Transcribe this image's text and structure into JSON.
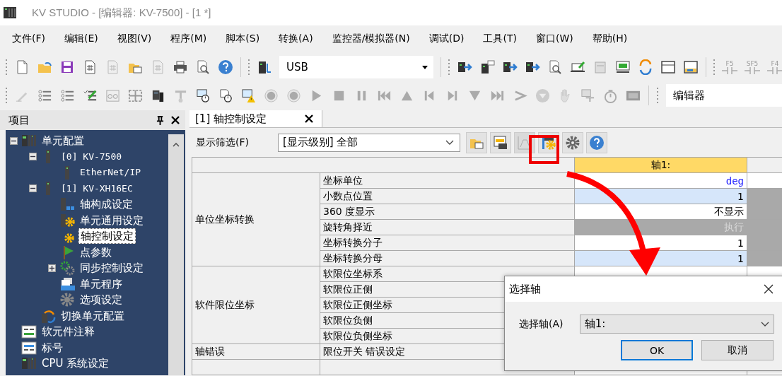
{
  "window": {
    "title": "KV STUDIO - [编辑器: KV-7500] - [1 *]"
  },
  "menu": [
    "文件(F)",
    "编辑(E)",
    "视图(V)",
    "程序(M)",
    "脚本(S)",
    "转换(A)",
    "监控器/模拟器(N)",
    "调试(D)",
    "工具(T)",
    "窗口(W)",
    "帮助(H)"
  ],
  "toolbar": {
    "connection_field": {
      "value": "USB"
    },
    "key_icons": [
      "F5",
      "SF5",
      "F4"
    ],
    "mode_field": {
      "value": "编辑器"
    }
  },
  "project_panel": {
    "title": "项目",
    "tree": [
      {
        "label": "单元配置",
        "kind": "rack",
        "expanded": true,
        "selected": false,
        "children": [
          {
            "label": "[0]  KV-7500",
            "kind": "module",
            "expanded": true,
            "selected": false,
            "children": [
              {
                "label": "EtherNet/IP",
                "kind": "module",
                "selected": false
              }
            ]
          },
          {
            "label": "[1]  KV-XH16EC",
            "kind": "module",
            "expanded": true,
            "selected": false,
            "children": [
              {
                "label": "轴构成设定",
                "kind": "axis-config",
                "selected": false
              },
              {
                "label": "单元通用设定",
                "kind": "unit-settings",
                "selected": false
              },
              {
                "label": "轴控制设定",
                "kind": "axis-control",
                "selected": true
              },
              {
                "label": "点参数",
                "kind": "flag",
                "selected": false
              },
              {
                "label": "同步控制设定",
                "kind": "sync",
                "expanded": false,
                "selected": false
              },
              {
                "label": "单元程序",
                "kind": "program",
                "selected": false
              },
              {
                "label": "选项设定",
                "kind": "option",
                "selected": false
              }
            ]
          },
          {
            "label": "切换单元配置",
            "kind": "switch",
            "selected": false
          }
        ]
      },
      {
        "label": "软元件注释",
        "kind": "comment",
        "selected": false
      },
      {
        "label": "标号",
        "kind": "label",
        "selected": false
      },
      {
        "label": "CPU 系统设定",
        "kind": "rack",
        "selected": false
      }
    ]
  },
  "tabs": [
    {
      "label": "[1] 轴控制设定",
      "selected": true
    }
  ],
  "filter": {
    "label": "显示筛选(F)",
    "value": "[显示级别] 全部"
  },
  "table": {
    "axis_heading": "轴1:",
    "groups": [
      {
        "name": "单位坐标转换",
        "rows": [
          {
            "label": "坐标单位",
            "kind": "unit",
            "value": "deg",
            "highlighted": false,
            "disabled": false,
            "column_3_disabled": false
          },
          {
            "label": "小数点位置",
            "kind": "value",
            "value": "1",
            "highlighted": true,
            "disabled": false,
            "column_3_disabled": true
          },
          {
            "label": "360  度显示",
            "kind": "value",
            "value": "不显示",
            "highlighted": false,
            "disabled": false,
            "column_3_disabled": true
          },
          {
            "label": "旋转角择近",
            "kind": "value",
            "value": "执行",
            "highlighted": false,
            "disabled": true,
            "column_3_disabled": true
          },
          {
            "label": "坐标转换分子",
            "kind": "value",
            "value": "1",
            "highlighted": false,
            "disabled": false,
            "column_3_disabled": true
          },
          {
            "label": "坐标转换分母",
            "kind": "value",
            "value": "1",
            "highlighted": true,
            "disabled": false,
            "column_3_disabled": true
          }
        ]
      },
      {
        "name": "软件限位坐标",
        "rows": [
          {
            "label": "软限位坐标系"
          },
          {
            "label": "软限位正侧"
          },
          {
            "label": "软限位正侧坐标"
          },
          {
            "label": "软限位负侧"
          },
          {
            "label": "软限位负侧坐标"
          }
        ]
      },
      {
        "name": "轴错误",
        "rows": [
          {
            "label": "限位开关  错误设定"
          }
        ]
      }
    ]
  },
  "dialog": {
    "title": "选择轴",
    "field_label": "选择轴(A)",
    "field_value": "轴1:",
    "buttons": [
      {
        "label": "OK",
        "selected": true
      },
      {
        "label": "取消",
        "selected": false
      }
    ]
  }
}
